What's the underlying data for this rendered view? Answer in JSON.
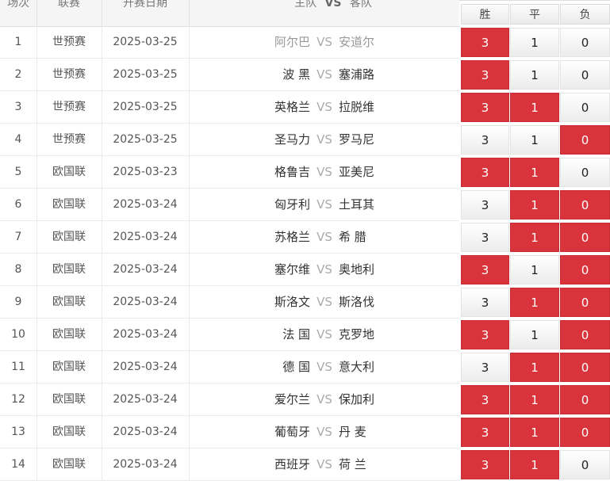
{
  "header": {
    "col_no": "场次",
    "col_league": "联赛",
    "col_date": "开赛日期",
    "col_home": "主队",
    "col_vs": "VS",
    "col_away": "客队",
    "win": "胜",
    "draw": "平",
    "lose": "负"
  },
  "colors": {
    "selected": "#d9333b",
    "accent_text": "#ffffff"
  },
  "rows": [
    {
      "no": "1",
      "league": "世预赛",
      "date": "2025-03-25",
      "home": "阿尔巴",
      "vs": "VS",
      "away": "安道尔",
      "win": "3",
      "draw": "1",
      "lose": "0",
      "sel": [
        true,
        false,
        false
      ],
      "dim": true
    },
    {
      "no": "2",
      "league": "世预赛",
      "date": "2025-03-25",
      "home": "波 黑",
      "vs": "VS",
      "away": "塞浦路",
      "win": "3",
      "draw": "1",
      "lose": "0",
      "sel": [
        true,
        false,
        false
      ],
      "dim": false
    },
    {
      "no": "3",
      "league": "世预赛",
      "date": "2025-03-25",
      "home": "英格兰",
      "vs": "VS",
      "away": "拉脱维",
      "win": "3",
      "draw": "1",
      "lose": "0",
      "sel": [
        true,
        true,
        false
      ],
      "dim": false
    },
    {
      "no": "4",
      "league": "世预赛",
      "date": "2025-03-25",
      "home": "圣马力",
      "vs": "VS",
      "away": "罗马尼",
      "win": "3",
      "draw": "1",
      "lose": "0",
      "sel": [
        false,
        false,
        true
      ],
      "dim": false
    },
    {
      "no": "5",
      "league": "欧国联",
      "date": "2025-03-23",
      "home": "格鲁吉",
      "vs": "VS",
      "away": "亚美尼",
      "win": "3",
      "draw": "1",
      "lose": "0",
      "sel": [
        true,
        true,
        false
      ],
      "dim": false
    },
    {
      "no": "6",
      "league": "欧国联",
      "date": "2025-03-24",
      "home": "匈牙利",
      "vs": "VS",
      "away": "土耳其",
      "win": "3",
      "draw": "1",
      "lose": "0",
      "sel": [
        false,
        true,
        true
      ],
      "dim": false
    },
    {
      "no": "7",
      "league": "欧国联",
      "date": "2025-03-24",
      "home": "苏格兰",
      "vs": "VS",
      "away": "希 腊",
      "win": "3",
      "draw": "1",
      "lose": "0",
      "sel": [
        false,
        true,
        true
      ],
      "dim": false
    },
    {
      "no": "8",
      "league": "欧国联",
      "date": "2025-03-24",
      "home": "塞尔维",
      "vs": "VS",
      "away": "奥地利",
      "win": "3",
      "draw": "1",
      "lose": "0",
      "sel": [
        true,
        false,
        true
      ],
      "dim": false
    },
    {
      "no": "9",
      "league": "欧国联",
      "date": "2025-03-24",
      "home": "斯洛文",
      "vs": "VS",
      "away": "斯洛伐",
      "win": "3",
      "draw": "1",
      "lose": "0",
      "sel": [
        false,
        true,
        true
      ],
      "dim": false
    },
    {
      "no": "10",
      "league": "欧国联",
      "date": "2025-03-24",
      "home": "法 国",
      "vs": "VS",
      "away": "克罗地",
      "win": "3",
      "draw": "1",
      "lose": "0",
      "sel": [
        true,
        false,
        true
      ],
      "dim": false
    },
    {
      "no": "11",
      "league": "欧国联",
      "date": "2025-03-24",
      "home": "德 国",
      "vs": "VS",
      "away": "意大利",
      "win": "3",
      "draw": "1",
      "lose": "0",
      "sel": [
        false,
        true,
        true
      ],
      "dim": false
    },
    {
      "no": "12",
      "league": "欧国联",
      "date": "2025-03-24",
      "home": "爱尔兰",
      "vs": "VS",
      "away": "保加利",
      "win": "3",
      "draw": "1",
      "lose": "0",
      "sel": [
        true,
        true,
        true
      ],
      "dim": false
    },
    {
      "no": "13",
      "league": "欧国联",
      "date": "2025-03-24",
      "home": "葡萄牙",
      "vs": "VS",
      "away": "丹 麦",
      "win": "3",
      "draw": "1",
      "lose": "0",
      "sel": [
        true,
        true,
        true
      ],
      "dim": false
    },
    {
      "no": "14",
      "league": "欧国联",
      "date": "2025-03-24",
      "home": "西班牙",
      "vs": "VS",
      "away": "荷 兰",
      "win": "3",
      "draw": "1",
      "lose": "0",
      "sel": [
        true,
        true,
        false
      ],
      "dim": false
    }
  ]
}
